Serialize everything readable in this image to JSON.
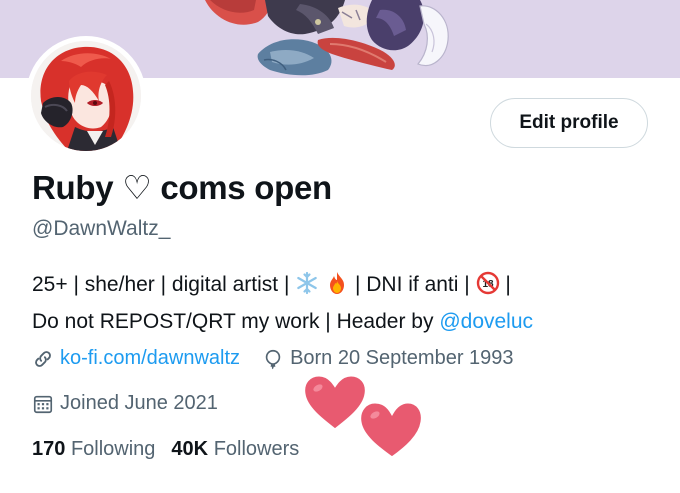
{
  "profile": {
    "edit_button_label": "Edit profile",
    "display_name": "Ruby",
    "name_heart": "♡",
    "name_suffix": "coms open",
    "handle": "@DawnWaltz_",
    "bio": {
      "line1_a": "25+ | she/her | digital artist |",
      "line1_b": "| DNI if anti |",
      "line1_c": "|",
      "line2_a": "Do not REPOST/QRT my work | Header by",
      "mention": "@doveluc"
    },
    "website": "ko-fi.com/dawnwaltz",
    "birthday": "Born 20 September 1993",
    "joined": "Joined June 2021",
    "following_count": "170",
    "following_label": "Following",
    "followers_count": "40K",
    "followers_label": "Followers"
  },
  "emoji": {
    "bio_1": "snowflake-emoji",
    "bio_2": "fire-emoji",
    "bio_3": "no-one-under-eighteen-emoji",
    "eighteen_label": "18"
  },
  "colors": {
    "accent": "#1d9bf0",
    "secondary_text": "#536471",
    "sticker_heart": "#e85a70"
  }
}
